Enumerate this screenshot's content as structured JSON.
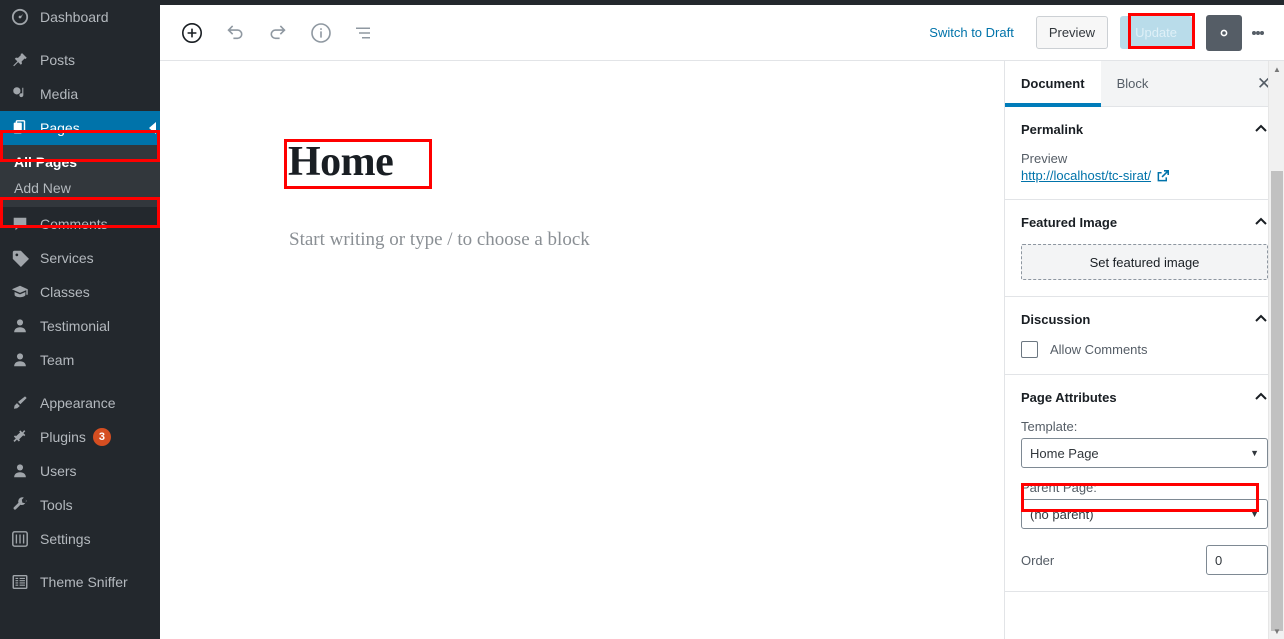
{
  "colors": {
    "admin_bg": "#23282d",
    "submenu_bg": "#32373c",
    "active_blue": "#0073aa",
    "annotation_red": "#ff0000",
    "badge_orange": "#d54e21",
    "tab_accent": "#007cba"
  },
  "sidebar": {
    "items": [
      {
        "label": "Dashboard",
        "icon": "dashboard-icon"
      },
      {
        "label": "Posts",
        "icon": "pin-icon"
      },
      {
        "label": "Media",
        "icon": "media-icon"
      },
      {
        "label": "Pages",
        "icon": "pages-icon",
        "current": true
      },
      {
        "label": "Comments",
        "icon": "comment-icon"
      },
      {
        "label": "Services",
        "icon": "tag-icon"
      },
      {
        "label": "Classes",
        "icon": "graduation-icon"
      },
      {
        "label": "Testimonial",
        "icon": "user-icon"
      },
      {
        "label": "Team",
        "icon": "user-icon"
      },
      {
        "label": "Appearance",
        "icon": "brush-icon"
      },
      {
        "label": "Plugins",
        "icon": "plug-icon",
        "badge": "3"
      },
      {
        "label": "Users",
        "icon": "users-icon"
      },
      {
        "label": "Tools",
        "icon": "wrench-icon"
      },
      {
        "label": "Settings",
        "icon": "settings-icon"
      },
      {
        "label": "Theme Sniffer",
        "icon": "list-icon"
      }
    ],
    "submenu": [
      {
        "label": "All Pages",
        "active": true
      },
      {
        "label": "Add New",
        "active": false
      }
    ]
  },
  "toolbar": {
    "add_block_title": "Add block",
    "undo_title": "Undo",
    "redo_title": "Redo",
    "info_title": "Content structure",
    "list_view_title": "Block navigation",
    "switch_to_draft": "Switch to Draft",
    "preview": "Preview",
    "update": "Update",
    "settings_title": "Settings",
    "more_title": "More tools & options"
  },
  "editor": {
    "title": "Home",
    "placeholder": "Start writing or type / to choose a block"
  },
  "panel": {
    "tabs": [
      {
        "label": "Document",
        "active": true
      },
      {
        "label": "Block",
        "active": false
      }
    ],
    "close_label": "✕",
    "permalink": {
      "title": "Permalink",
      "preview_label": "Preview",
      "url": "http://localhost/tc-sirat/"
    },
    "featured_image": {
      "title": "Featured Image",
      "button": "Set featured image"
    },
    "discussion": {
      "title": "Discussion",
      "allow_comments_label": "Allow Comments",
      "allow_comments_checked": false
    },
    "page_attributes": {
      "title": "Page Attributes",
      "template_label": "Template:",
      "template_value": "Home Page",
      "parent_label": "Parent Page:",
      "parent_value": "(no parent)",
      "order_label": "Order",
      "order_value": "0"
    }
  }
}
